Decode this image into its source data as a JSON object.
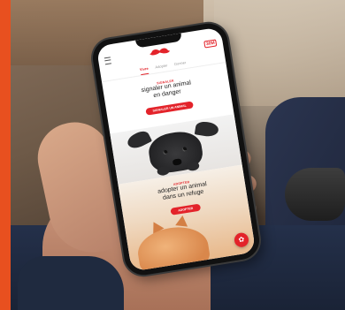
{
  "header": {
    "menu_icon": "hamburger-icon",
    "logo_icon": "mustache-logo-icon",
    "brand_badge": "30M"
  },
  "tabs": [
    {
      "label": "Vivre",
      "active": true
    },
    {
      "label": "Adopter",
      "active": false
    },
    {
      "label": "Donner",
      "active": false
    }
  ],
  "sections": {
    "report": {
      "kicker": "SIGNALER",
      "headline_line1": "signaler un animal",
      "headline_line2": "en danger",
      "cta": "SIGNALER UN ANIMAL"
    },
    "adopt": {
      "kicker": "ADOPTER",
      "headline_line1": "adopter un animal",
      "headline_line2": "dans un refuge",
      "cta": "ADOPTER"
    }
  },
  "fab": {
    "icon": "paw-heart-icon",
    "glyph": "✿"
  },
  "colors": {
    "accent": "#e3232a",
    "sidebar_bar": "#e8501f"
  }
}
